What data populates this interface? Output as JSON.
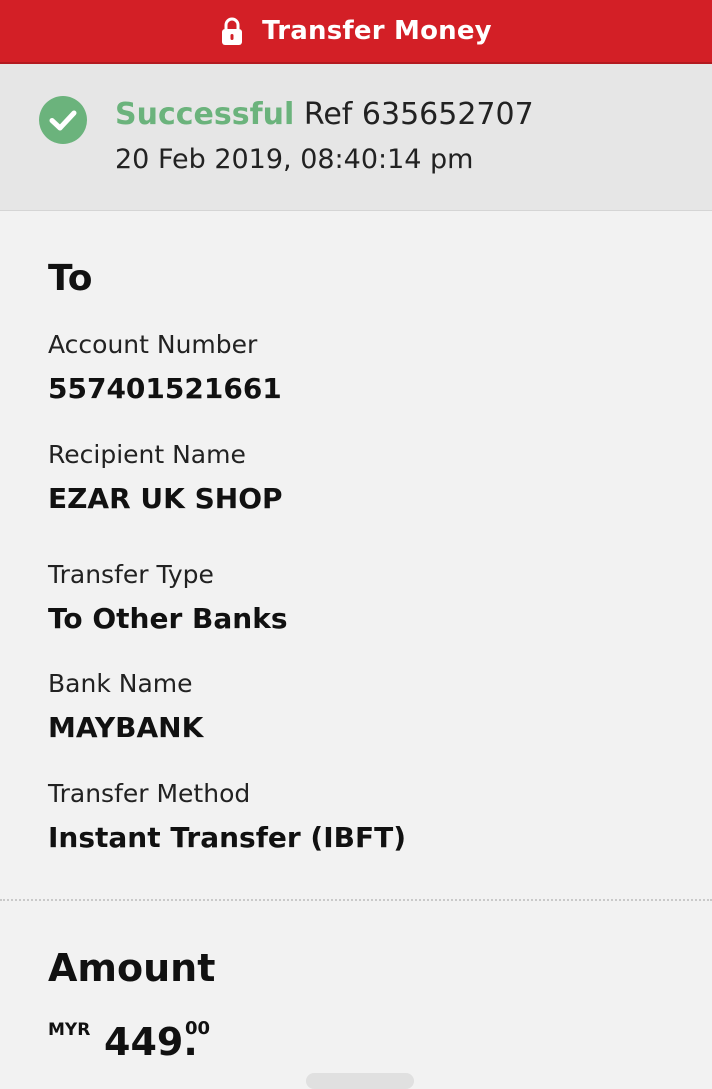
{
  "header": {
    "title": "Transfer Money",
    "icon": "lock-icon",
    "color": "#d31f26"
  },
  "status": {
    "state": "Successful",
    "ref": "Ref 635652707",
    "datetime": "20 Feb 2019, 08:40:14 pm",
    "icon": "check-circle-icon",
    "color": "#6bb37c"
  },
  "to": {
    "heading": "To",
    "fields": [
      {
        "label": "Account Number",
        "value": "557401521661"
      },
      {
        "label": "Recipient Name",
        "value": "EZAR UK SHOP"
      },
      {
        "label": "Transfer Type",
        "value": "To Other Banks"
      },
      {
        "label": "Bank Name",
        "value": "MAYBANK"
      },
      {
        "label": "Transfer Method",
        "value": "Instant Transfer (IBFT)"
      }
    ]
  },
  "amount": {
    "heading": "Amount",
    "currency": "MYR",
    "whole": "449.",
    "cents": "00"
  }
}
